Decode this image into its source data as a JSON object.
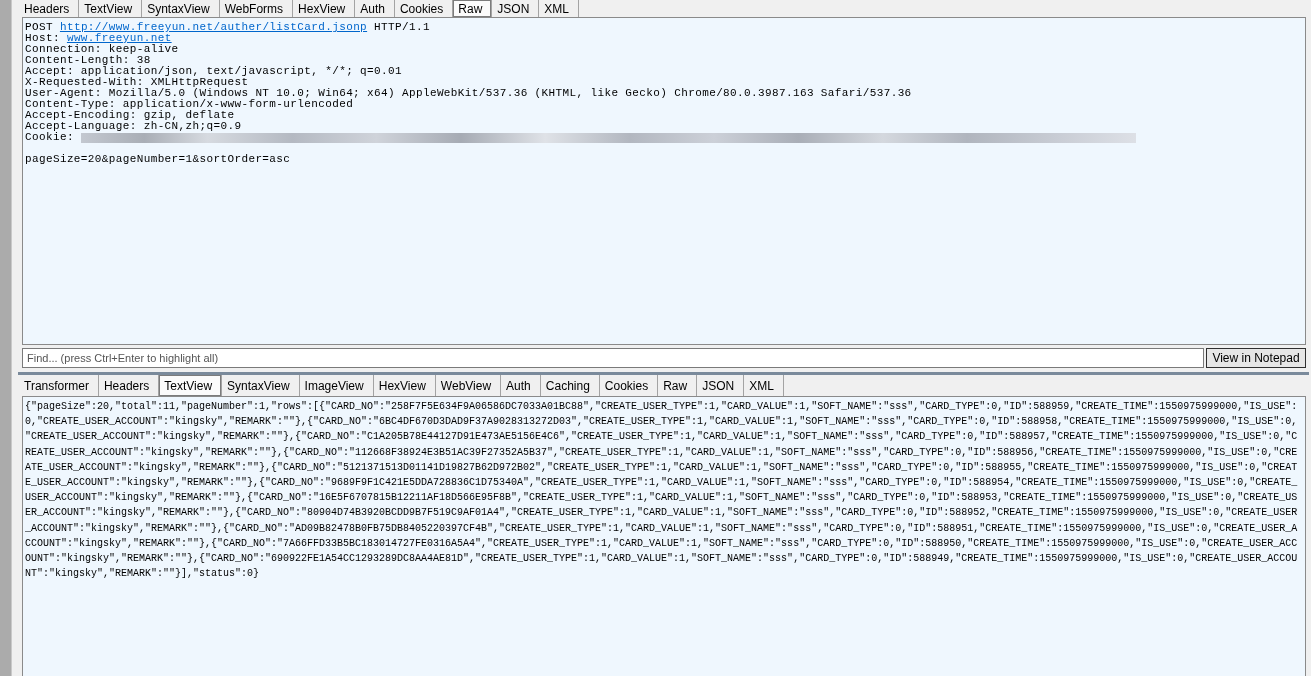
{
  "request_tabs": [
    {
      "label": "Headers",
      "selected": false
    },
    {
      "label": "TextView",
      "selected": false
    },
    {
      "label": "SyntaxView",
      "selected": false
    },
    {
      "label": "WebForms",
      "selected": false
    },
    {
      "label": "HexView",
      "selected": false
    },
    {
      "label": "Auth",
      "selected": false
    },
    {
      "label": "Cookies",
      "selected": false
    },
    {
      "label": "Raw",
      "selected": true
    },
    {
      "label": "JSON",
      "selected": false
    },
    {
      "label": "XML",
      "selected": false
    }
  ],
  "request": {
    "method": "POST",
    "url": "http://www.freeyun.net/auther/listCard.jsonp",
    "version": "HTTP/1.1",
    "headers": [
      {
        "text": "Host:",
        "link": "www.freeyun.net"
      },
      {
        "text": "Connection: keep-alive"
      },
      {
        "text": "Content-Length: 38"
      },
      {
        "text": "Accept: application/json, text/javascript, */*; q=0.01"
      },
      {
        "text": "X-Requested-With: XMLHttpRequest"
      },
      {
        "text": "User-Agent: Mozilla/5.0 (Windows NT 10.0; Win64; x64) AppleWebKit/537.36 (KHTML, like Gecko) Chrome/80.0.3987.163 Safari/537.36"
      },
      {
        "text": "Content-Type: application/x-www-form-urlencoded"
      },
      {
        "text": "Accept-Encoding: gzip, deflate"
      },
      {
        "text": "Accept-Language: zh-CN,zh;q=0.9"
      },
      {
        "text": "Cookie:",
        "redacted": true
      }
    ],
    "body": "pageSize=20&pageNumber=1&sortOrder=asc"
  },
  "find": {
    "placeholder": "Find... (press Ctrl+Enter to highlight all)"
  },
  "view_in_notepad_button": "View in Notepad",
  "response_tabs": [
    {
      "label": "Transformer",
      "selected": false
    },
    {
      "label": "Headers",
      "selected": false
    },
    {
      "label": "TextView",
      "selected": true
    },
    {
      "label": "SyntaxView",
      "selected": false
    },
    {
      "label": "ImageView",
      "selected": false
    },
    {
      "label": "HexView",
      "selected": false
    },
    {
      "label": "WebView",
      "selected": false
    },
    {
      "label": "Auth",
      "selected": false
    },
    {
      "label": "Caching",
      "selected": false
    },
    {
      "label": "Cookies",
      "selected": false
    },
    {
      "label": "Raw",
      "selected": false
    },
    {
      "label": "JSON",
      "selected": false
    },
    {
      "label": "XML",
      "selected": false
    }
  ],
  "response": {
    "lines": [
      "{\"pageSize\":20,\"total\":11,\"pageNumber\":1,\"rows\":[{\"CARD_NO\":\"258F7F5E634F9A06586DC7033A01BC88\",\"CREATE_USER_TYPE\":1,\"CARD_VALUE\":1,\"SOFT_NAME\":\"sss\",\"CARD_TYPE\":0,\"ID\":588959,\"CREATE_TIME\":1550975999000,\"IS_USE\":",
      "0,\"CREATE_USER_ACCOUNT\":\"kingsky\",\"REMARK\":\"\"},{\"CARD_NO\":\"6BC4DF670D3DAD9F37A9028313272D03\",\"CREATE_USER_TYPE\":1,\"CARD_VALUE\":1,\"SOFT_NAME\":\"sss\",\"CARD_TYPE\":0,\"ID\":588958,\"CREATE_TIME\":1550975999000,\"IS_USE\":0,",
      "\"CREATE_USER_ACCOUNT\":\"kingsky\",\"REMARK\":\"\"},{\"CARD_NO\":\"C1A205B78E44127D91E473AE5156E4C6\",\"CREATE_USER_TYPE\":1,\"CARD_VALUE\":1,\"SOFT_NAME\":\"sss\",\"CARD_TYPE\":0,\"ID\":588957,\"CREATE_TIME\":1550975999000,\"IS_USE\":0,\"C",
      "REATE_USER_ACCOUNT\":\"kingsky\",\"REMARK\":\"\"},{\"CARD_NO\":\"112668F38924E3B51AC39F27352A5B37\",\"CREATE_USER_TYPE\":1,\"CARD_VALUE\":1,\"SOFT_NAME\":\"sss\",\"CARD_TYPE\":0,\"ID\":588956,\"CREATE_TIME\":1550975999000,\"IS_USE\":0,\"CRE",
      "ATE_USER_ACCOUNT\":\"kingsky\",\"REMARK\":\"\"},{\"CARD_NO\":\"5121371513D01141D19827B62D972B02\",\"CREATE_USER_TYPE\":1,\"CARD_VALUE\":1,\"SOFT_NAME\":\"sss\",\"CARD_TYPE\":0,\"ID\":588955,\"CREATE_TIME\":1550975999000,\"IS_USE\":0,\"CREAT",
      "E_USER_ACCOUNT\":\"kingsky\",\"REMARK\":\"\"},{\"CARD_NO\":\"9689F9F1C421E5DDA728836C1D75340A\",\"CREATE_USER_TYPE\":1,\"CARD_VALUE\":1,\"SOFT_NAME\":\"sss\",\"CARD_TYPE\":0,\"ID\":588954,\"CREATE_TIME\":1550975999000,\"IS_USE\":0,\"CREATE_",
      "USER_ACCOUNT\":\"kingsky\",\"REMARK\":\"\"},{\"CARD_NO\":\"16E5F6707815B12211AF18D566E95F8B\",\"CREATE_USER_TYPE\":1,\"CARD_VALUE\":1,\"SOFT_NAME\":\"sss\",\"CARD_TYPE\":0,\"ID\":588953,\"CREATE_TIME\":1550975999000,\"IS_USE\":0,\"CREATE_US",
      "ER_ACCOUNT\":\"kingsky\",\"REMARK\":\"\"},{\"CARD_NO\":\"80904D74B3920BCDD9B7F519C9AF01A4\",\"CREATE_USER_TYPE\":1,\"CARD_VALUE\":1,\"SOFT_NAME\":\"sss\",\"CARD_TYPE\":0,\"ID\":588952,\"CREATE_TIME\":1550975999000,\"IS_USE\":0,\"CREATE_USER",
      "_ACCOUNT\":\"kingsky\",\"REMARK\":\"\"},{\"CARD_NO\":\"AD09B82478B0FB75DB8405220397CF4B\",\"CREATE_USER_TYPE\":1,\"CARD_VALUE\":1,\"SOFT_NAME\":\"sss\",\"CARD_TYPE\":0,\"ID\":588951,\"CREATE_TIME\":1550975999000,\"IS_USE\":0,\"CREATE_USER_A",
      "CCOUNT\":\"kingsky\",\"REMARK\":\"\"},{\"CARD_NO\":\"7A66FFD33B5BC183014727FE0316A5A4\",\"CREATE_USER_TYPE\":1,\"CARD_VALUE\":1,\"SOFT_NAME\":\"sss\",\"CARD_TYPE\":0,\"ID\":588950,\"CREATE_TIME\":1550975999000,\"IS_USE\":0,\"CREATE_USER_ACC",
      "OUNT\":\"kingsky\",\"REMARK\":\"\"},{\"CARD_NO\":\"690922FE1A54CC1293289DC8AA4AE81D\",\"CREATE_USER_TYPE\":1,\"CARD_VALUE\":1,\"SOFT_NAME\":\"sss\",\"CARD_TYPE\":0,\"ID\":588949,\"CREATE_TIME\":1550975999000,\"IS_USE\":0,\"CREATE_USER_ACCOU",
      "NT\":\"kingsky\",\"REMARK\":\"\"}],\"status\":0}"
    ]
  }
}
